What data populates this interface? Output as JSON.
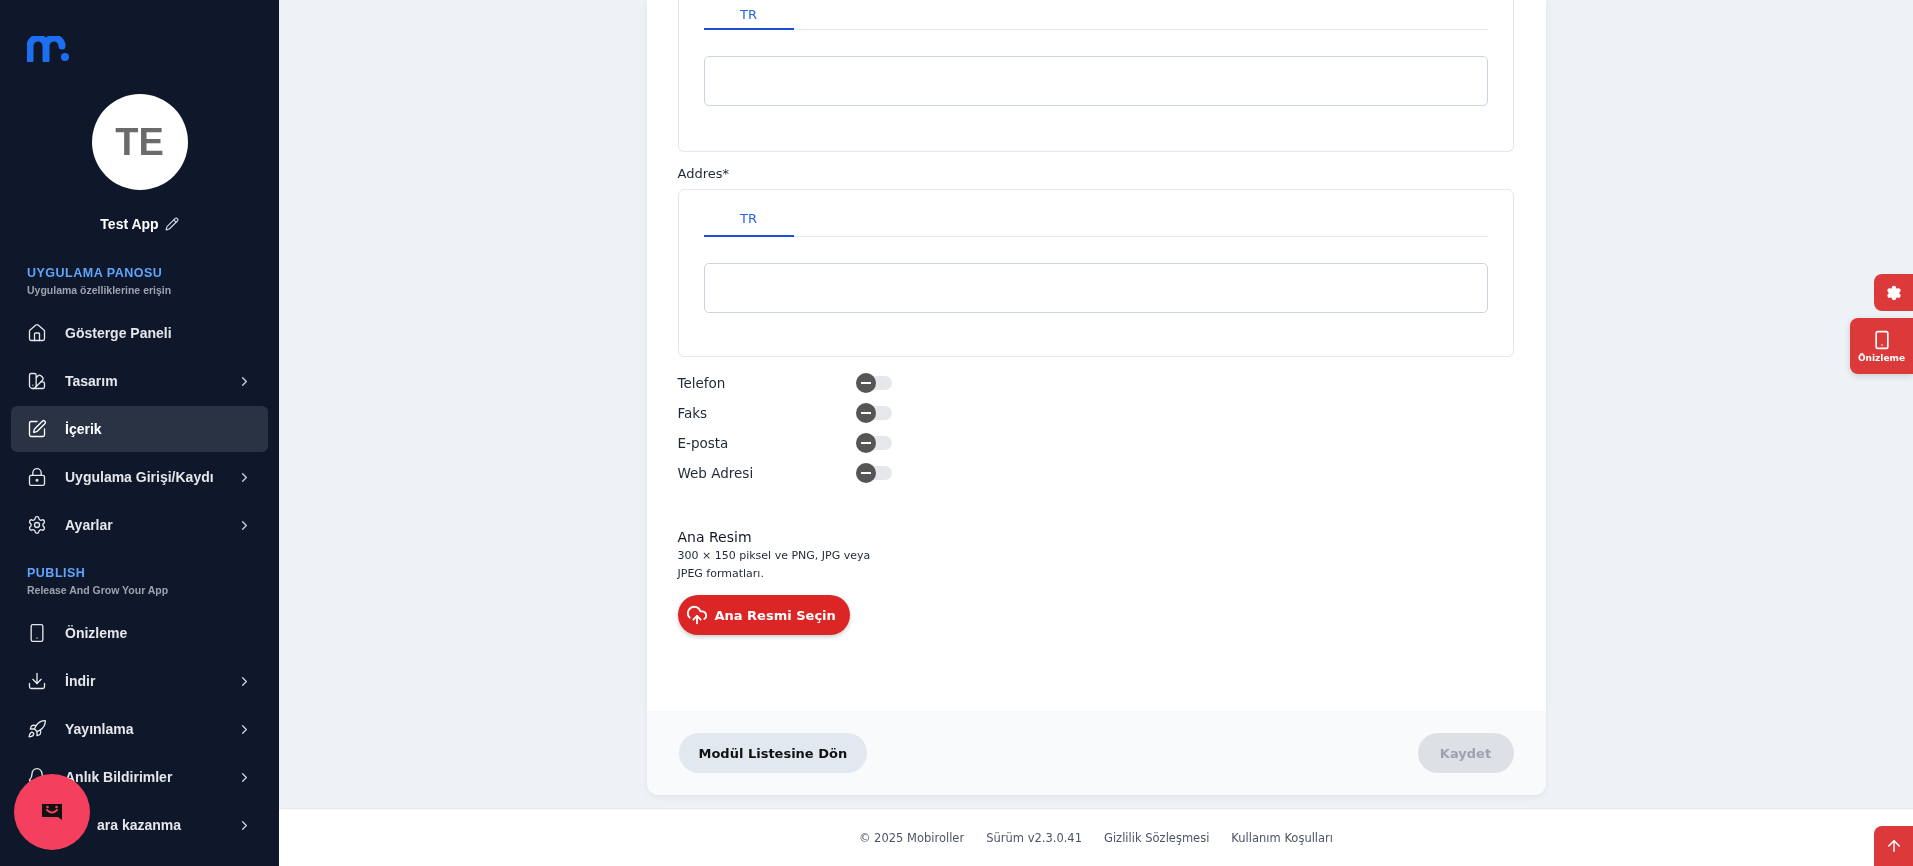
{
  "sidebar": {
    "app_name": "Test App",
    "avatar_initials": "TE",
    "sections": [
      {
        "title": "UYGULAMA PANOSU",
        "subtitle": "Uygulama özelliklerine erişin",
        "items": [
          {
            "label": "Gösterge Paneli",
            "selected": false,
            "has_submenu": false
          },
          {
            "label": "Tasarım",
            "selected": false,
            "has_submenu": true
          },
          {
            "label": "İçerik",
            "selected": true,
            "has_submenu": false
          },
          {
            "label": "Uygulama Girişi/Kaydı",
            "selected": false,
            "has_submenu": true
          },
          {
            "label": "Ayarlar",
            "selected": false,
            "has_submenu": true
          }
        ]
      },
      {
        "title": "PUBLISH",
        "subtitle": "Release And Grow Your App",
        "items": [
          {
            "label": "Önizleme",
            "selected": false,
            "has_submenu": false
          },
          {
            "label": "İndir",
            "selected": false,
            "has_submenu": true
          },
          {
            "label": "Yayınlama",
            "selected": false,
            "has_submenu": true
          },
          {
            "label": "Anlık Bildirimler",
            "selected": false,
            "has_submenu": true
          },
          {
            "label": "ara kazanma",
            "selected": false,
            "has_submenu": true,
            "covered": true
          }
        ]
      }
    ]
  },
  "form": {
    "fields": [
      {
        "tabs": [
          {
            "label": "TR",
            "selected": true
          }
        ]
      },
      {
        "label": "Addres*",
        "tabs": [
          {
            "label": "TR",
            "selected": true
          }
        ]
      }
    ],
    "toggles": [
      {
        "label": "Telefon",
        "on": false
      },
      {
        "label": "Faks",
        "on": false
      },
      {
        "label": "E-posta",
        "on": false
      },
      {
        "label": "Web Adresi",
        "on": false
      }
    ],
    "image": {
      "title": "Ana Resim",
      "hint": "300 × 150 piksel ve PNG, JPG veya JPEG formatları.",
      "button": "Ana Resmi Seçin"
    },
    "back_button": "Modül Listesine Dön",
    "save_button": {
      "label": "Kaydet",
      "disabled": true
    }
  },
  "side_panel": {
    "preview_label": "Önizleme"
  },
  "footer": [
    "© 2025 Mobiroller",
    "Sürüm v2.3.0.41",
    "Gizlilik Sözleşmesi",
    "Kullanım Koşulları"
  ]
}
